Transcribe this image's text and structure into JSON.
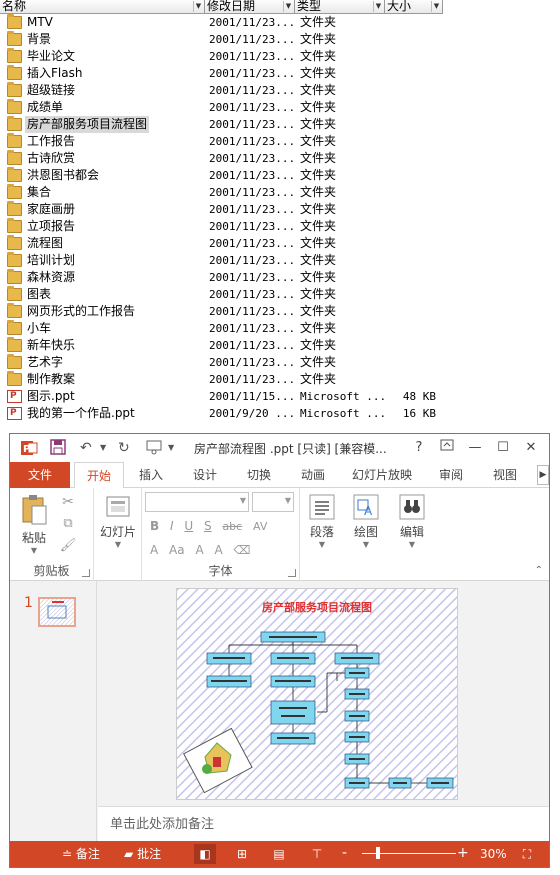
{
  "explorer": {
    "columns": {
      "name": "名称",
      "modified": "修改日期",
      "type": "类型",
      "size": "大小"
    },
    "rows": [
      {
        "name": "MTV",
        "date": "2001/11/23...",
        "type": "文件夹",
        "size": "",
        "icon": "folder-icon"
      },
      {
        "name": "背景",
        "date": "2001/11/23...",
        "type": "文件夹",
        "size": "",
        "icon": "folder-icon"
      },
      {
        "name": "毕业论文",
        "date": "2001/11/23...",
        "type": "文件夹",
        "size": "",
        "icon": "folder-icon"
      },
      {
        "name": "插入Flash",
        "date": "2001/11/23...",
        "type": "文件夹",
        "size": "",
        "icon": "folder-icon"
      },
      {
        "name": "超级链接",
        "date": "2001/11/23...",
        "type": "文件夹",
        "size": "",
        "icon": "folder-icon"
      },
      {
        "name": "成绩单",
        "date": "2001/11/23...",
        "type": "文件夹",
        "size": "",
        "icon": "folder-icon"
      },
      {
        "name": "房产部服务项目流程图",
        "date": "2001/11/23...",
        "type": "文件夹",
        "size": "",
        "icon": "folder-icon",
        "selected": true
      },
      {
        "name": "工作报告",
        "date": "2001/11/23...",
        "type": "文件夹",
        "size": "",
        "icon": "folder-icon"
      },
      {
        "name": "古诗欣赏",
        "date": "2001/11/23...",
        "type": "文件夹",
        "size": "",
        "icon": "folder-icon"
      },
      {
        "name": "洪恩图书都会",
        "date": "2001/11/23...",
        "type": "文件夹",
        "size": "",
        "icon": "folder-icon"
      },
      {
        "name": "集合",
        "date": "2001/11/23...",
        "type": "文件夹",
        "size": "",
        "icon": "folder-icon"
      },
      {
        "name": "家庭画册",
        "date": "2001/11/23...",
        "type": "文件夹",
        "size": "",
        "icon": "folder-icon"
      },
      {
        "name": "立项报告",
        "date": "2001/11/23...",
        "type": "文件夹",
        "size": "",
        "icon": "folder-icon"
      },
      {
        "name": "流程图",
        "date": "2001/11/23...",
        "type": "文件夹",
        "size": "",
        "icon": "folder-icon"
      },
      {
        "name": "培训计划",
        "date": "2001/11/23...",
        "type": "文件夹",
        "size": "",
        "icon": "folder-icon"
      },
      {
        "name": "森林资源",
        "date": "2001/11/23...",
        "type": "文件夹",
        "size": "",
        "icon": "folder-icon"
      },
      {
        "name": "图表",
        "date": "2001/11/23...",
        "type": "文件夹",
        "size": "",
        "icon": "folder-icon"
      },
      {
        "name": "网页形式的工作报告",
        "date": "2001/11/23...",
        "type": "文件夹",
        "size": "",
        "icon": "folder-icon"
      },
      {
        "name": "小车",
        "date": "2001/11/23...",
        "type": "文件夹",
        "size": "",
        "icon": "folder-icon"
      },
      {
        "name": "新年快乐",
        "date": "2001/11/23...",
        "type": "文件夹",
        "size": "",
        "icon": "folder-icon"
      },
      {
        "name": "艺术字",
        "date": "2001/11/23...",
        "type": "文件夹",
        "size": "",
        "icon": "folder-icon"
      },
      {
        "name": "制作教案",
        "date": "2001/11/23...",
        "type": "文件夹",
        "size": "",
        "icon": "folder-icon"
      },
      {
        "name": "图示.ppt",
        "date": "2001/11/15...",
        "type": "Microsoft ...",
        "size": "48 KB",
        "icon": "ppt-file-icon"
      },
      {
        "name": "我的第一个作品.ppt",
        "date": "2001/9/20 ...",
        "type": "Microsoft ...",
        "size": "16 KB",
        "icon": "ppt-file-icon"
      }
    ]
  },
  "ppt": {
    "title": "房产部流程图 .ppt [只读] [兼容模...",
    "window_controls": {
      "help": "?",
      "minimize": "—",
      "restore": "☐",
      "close": "✕"
    },
    "tabs": [
      "文件",
      "开始",
      "插入",
      "设计",
      "切换",
      "动画",
      "幻灯片放映",
      "审阅",
      "视图"
    ],
    "active_tab": "开始",
    "ribbon": {
      "paste": "粘贴",
      "slides": "幻灯片",
      "paragraph": "段落",
      "drawing": "绘图",
      "editing": "编辑",
      "groups": {
        "clipboard": "剪贴板",
        "font": "字体"
      },
      "font_buttons": [
        "B",
        "I",
        "U",
        "S",
        "abc",
        "AV"
      ],
      "font_buttons2": [
        "A",
        "Aa",
        "A",
        "A"
      ]
    },
    "slide_number": "1",
    "slide_title": "房产部服务项目流程图",
    "notes_placeholder": "单击此处添加备注",
    "status": {
      "notes": "备注",
      "comments": "批注",
      "zoom": "30%"
    },
    "colors": {
      "accent": "#d24726",
      "slide_title": "#e03030",
      "flow_box": "#7fd6ee"
    }
  }
}
